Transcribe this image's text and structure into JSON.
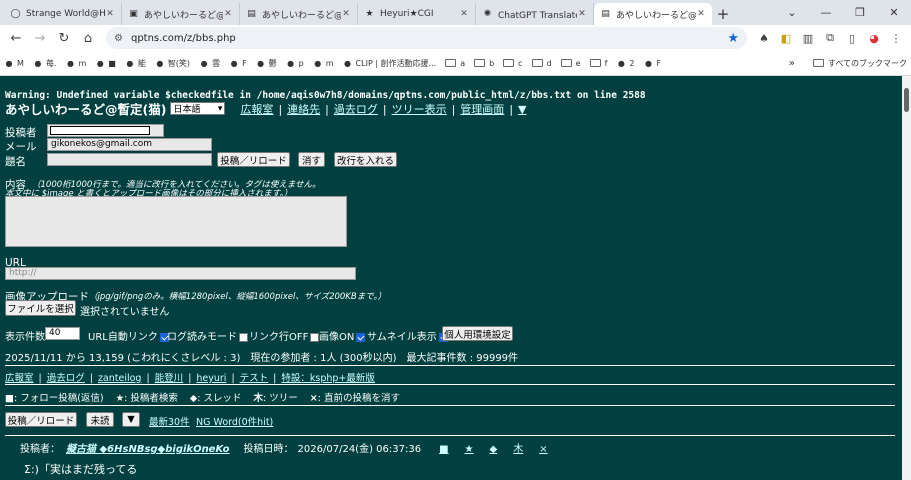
{
  "tabs": [
    {
      "title": "Strange World@Heyu",
      "icon": "globe-icon",
      "glyph": "◯"
    },
    {
      "title": "あやしいわーるど@みさ",
      "icon": "cat-icon",
      "glyph": "▣"
    },
    {
      "title": "あやしいわーるど@おこめ",
      "icon": "doc-icon",
      "glyph": "▤"
    },
    {
      "title": "Heyuri★CGI",
      "icon": "star-icon",
      "glyph": "★"
    },
    {
      "title": "ChatGPT Translate | 英",
      "icon": "chatgpt-icon",
      "glyph": "✺"
    },
    {
      "title": "あやしいわーるど@暫定",
      "icon": "doc-icon",
      "glyph": "▤"
    }
  ],
  "omnibox": {
    "url": "qptns.com/z/bbs.php"
  },
  "bookmarks": [
    {
      "label": "M",
      "icon": "gmail-icon"
    },
    {
      "label": "苺.",
      "icon": "strawberry-icon"
    },
    {
      "label": "m",
      "icon": "face-icon"
    },
    {
      "label": "■",
      "icon": "bookmark-icon"
    },
    {
      "label": "能",
      "icon": "bookmark-icon"
    },
    {
      "label": "智(笑)",
      "icon": "bookmark-icon"
    },
    {
      "label": "雲",
      "icon": "bookmark-icon"
    },
    {
      "label": "F",
      "icon": "bookmark-icon"
    },
    {
      "label": "鬱",
      "icon": "bookmark-icon"
    },
    {
      "label": "p",
      "icon": "bookmark-icon"
    },
    {
      "label": "m",
      "icon": "bookmark-icon"
    },
    {
      "label": "CLIP | 創作活動応援...",
      "icon": "clip-icon"
    },
    {
      "label": "a",
      "icon": "folder-icon"
    },
    {
      "label": "b",
      "icon": "folder-icon"
    },
    {
      "label": "c",
      "icon": "folder-icon"
    },
    {
      "label": "d",
      "icon": "folder-icon"
    },
    {
      "label": "e",
      "icon": "folder-icon"
    },
    {
      "label": "f",
      "icon": "folder-icon"
    },
    {
      "label": "2",
      "icon": "bookmark-icon"
    },
    {
      "label": "F",
      "icon": "bookmark-icon"
    }
  ],
  "bookmarks_more": "»",
  "all_bookmarks": "すべてのブックマーク",
  "warning": "Warning: Undefined variable $checkedfile in /home/aqis0w7h8/domains/qptns.com/public_html/z/bbs.txt on line 2588",
  "bbs_title": "あやしいわーるど@暫定(猫)",
  "language": "日本語",
  "nav_links": [
    "広報室",
    "連絡先",
    "過去ログ",
    "ツリー表示",
    "管理画面",
    "▼"
  ],
  "form": {
    "name_label": "投稿者",
    "name_value": "",
    "email_label": "メール",
    "email_value": "gikonekos@gmail.com",
    "subject_label": "題名",
    "subject_value": "",
    "post_button": "投稿／リロード",
    "clear_button": "消す",
    "newline_button": "改行を入れる",
    "content_label": "内容",
    "content_note_1": "（1000桁1000行まで。適当に改行を入れてください。タグは使えません。",
    "content_note_2": "本文中に $image と書くとアップロード画像はその部分に挿入されます。）",
    "url_label": "URL",
    "url_placeholder": "http://",
    "image_label": "画像アップロード",
    "image_note": "（jpg/gif/pngのみ。横幅1280pixel、縦幅1600pixel、サイズ200KBまで。）",
    "file_button": "ファイルを選択",
    "file_status": "選択されていません"
  },
  "options": {
    "display_count_label": "表示件数",
    "display_count": "40",
    "auto_link": "URL自動リンク",
    "readlog_mode": "ログ読みモード",
    "link_off": "リンク行OFF",
    "image_on": "画像ON",
    "thumbnail": "サムネイル表示",
    "personal_settings": "個人用環境設定"
  },
  "stats": "2025/11/11 から 13,159 (こわれにくさレベル : 3)　現在の参加者 : 1人 (300秒以内)　最大記事件数 : 99999件",
  "sub_links": [
    "広報室",
    "過去ログ",
    "zanteilog",
    "能登川",
    "heyuri",
    "テスト",
    "特設：ksphp+最新版"
  ],
  "legend": [
    {
      "sym": "■",
      "text": "フォロー投稿(返信)"
    },
    {
      "sym": "★",
      "text": "投稿者検索"
    },
    {
      "sym": "◆",
      "text": "スレッド"
    },
    {
      "sym": "木",
      "text": "ツリー"
    },
    {
      "sym": "×",
      "text": "直前の投稿を消す"
    }
  ],
  "bottom_bar": {
    "post_reload": "投稿／リロード",
    "unread": "未読",
    "toggle": "▼",
    "latest": "最新30件",
    "ngword": "NG Word(0件hit)"
  },
  "post": {
    "poster_label": "投稿者：",
    "poster": "擬古猫 ◆6HsNBsg◆bigikOneKo",
    "date_label": "投稿日時：",
    "date": "2026/07/24(金) 06:37:36",
    "icons": [
      "■",
      "★",
      "◆",
      "木",
      "×"
    ],
    "body": "Σ:)「実はまだ残ってる"
  }
}
